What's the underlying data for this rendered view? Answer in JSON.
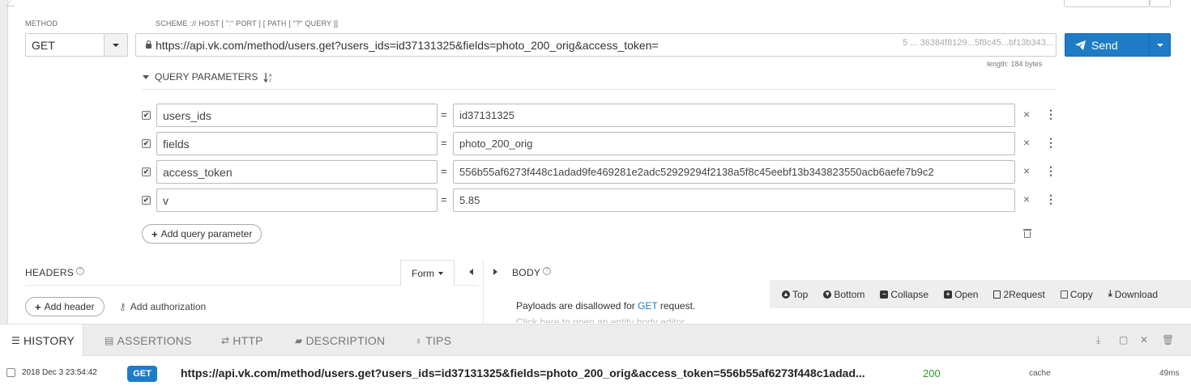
{
  "request": {
    "method_label": "METHOD",
    "url_label": "SCHEME :// HOST [ \":\" PORT ] [ PATH [ \"?\" QUERY ]]",
    "method": "GET",
    "url": "https://api.vk.com/method/users.get?users_ids=id37131325&fields=photo_200_orig&access_token=",
    "url_tail": "5 ... 36384f8129...5f8c45...bf13b343...",
    "length": "length: 184 bytes",
    "send_label": "Send"
  },
  "query": {
    "header": "QUERY PARAMETERS",
    "sort_icon": "sort-alpha-icon",
    "params": [
      {
        "key": "users_ids",
        "value": "id37131325",
        "checked": true
      },
      {
        "key": "fields",
        "value": "photo_200_orig",
        "checked": true
      },
      {
        "key": "access_token",
        "value": "556b55af6273f448c1adad9fe469281e2adc52929294f2138a5f8c45eebf13b343823550acb6aefe7b9c2",
        "checked": true
      },
      {
        "key": "v",
        "value": "5.85",
        "checked": true
      }
    ],
    "equals": "=",
    "add_label": "Add query parameter"
  },
  "headers": {
    "title": "HEADERS",
    "form_label": "Form",
    "add_header": "Add header",
    "add_auth": "Add authorization"
  },
  "body": {
    "title": "BODY",
    "payload_prefix": "Payloads are disallowed for ",
    "payload_method": "GET",
    "payload_suffix": " request.",
    "payload_hint": "Click here to open an entity body editor"
  },
  "toolbar": {
    "top": "Top",
    "bottom": "Bottom",
    "collapse": "Collapse",
    "open": "Open",
    "to_request": "2Request",
    "copy": "Copy",
    "download": "Download"
  },
  "bottom_tabs": {
    "history": "HISTORY",
    "assertions": "ASSERTIONS",
    "http": "HTTP",
    "description": "DESCRIPTION",
    "tips": "TIPS"
  },
  "history": [
    {
      "date": "2018 Dec 3 23:54:42",
      "method": "GET",
      "url": "https://api.vk.com/method/users.get?users_ids=id37131325&fields=photo_200_orig&access_token=556b55af6273f448c1adad...",
      "status": "200",
      "cache": "cache",
      "time": "49ms"
    }
  ],
  "colors": {
    "accent": "#1e7bc8",
    "status_ok": "#2a9d2a"
  }
}
